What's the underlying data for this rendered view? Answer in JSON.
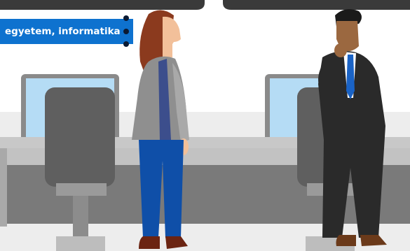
{
  "caption": {
    "text": "egyetem, informatika"
  },
  "scene": {
    "people": [
      "woman-looking-up",
      "man-thinking"
    ],
    "colors": {
      "background": "#ffffff",
      "floor": "#e8e8e8",
      "desk_top": "#c8c8c8",
      "desk_front": "#7a7a7a",
      "monitor_screen": "#b5dcf5",
      "chair": "#5f5f5f",
      "accent_blue": "#0e72cf",
      "dark_header": "#3a3a3a"
    }
  }
}
